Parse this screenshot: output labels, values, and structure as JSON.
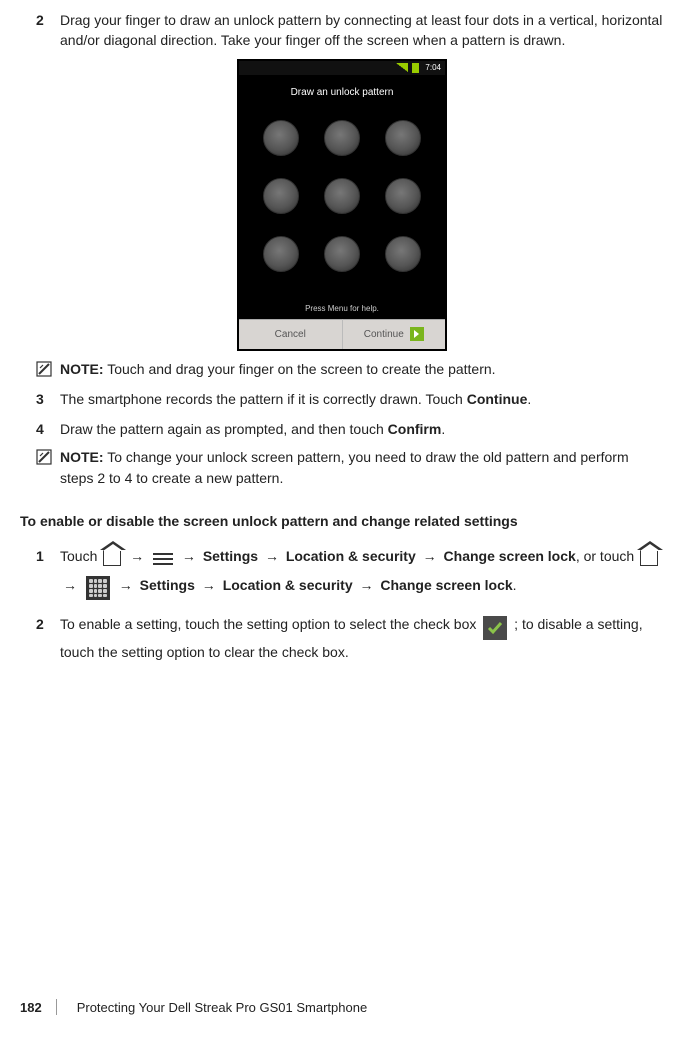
{
  "steps_a": {
    "s2": {
      "num": "2",
      "text_a": "Drag your finger to draw an unlock pattern by connecting at least four dots in a vertical, horizontal and/or diagonal direction. Take your finger off the screen when a pattern is drawn."
    },
    "s3": {
      "num": "3",
      "text_a": "The smartphone records the pattern if it is correctly drawn. Touch ",
      "text_b": "Continue",
      "text_c": "."
    },
    "s4": {
      "num": "4",
      "text_a": "Draw the pattern again as prompted, and then touch ",
      "text_b": "Confirm",
      "text_c": "."
    }
  },
  "phone": {
    "time": "7:04",
    "title": "Draw an unlock pattern",
    "help": "Press Menu for help.",
    "cancel": "Cancel",
    "continue": "Continue"
  },
  "notes": {
    "label": "NOTE:",
    "n1": " Touch and drag your finger on the screen to create the pattern.",
    "n2": " To change your unlock screen pattern, you need to draw the old pattern and perform steps 2 to 4 to create a new pattern."
  },
  "section_heading": "To enable or disable the screen unlock pattern and change related settings",
  "steps_b": {
    "s1": {
      "num": "1",
      "t1": "Touch ",
      "arrow": "→",
      "t2": " Settings ",
      "t3": " Location & security ",
      "t4": " Change screen lock",
      "t5": ", or touch ",
      "t6": " Settings ",
      "t7": " Location & security ",
      "t8": " Change screen lock",
      "t9": "."
    },
    "s2": {
      "num": "2",
      "t1": "To enable a setting, touch the setting option to select the check box ",
      "t2": " ; to disable a setting, touch the setting option to clear the check box."
    }
  },
  "footer": {
    "page": "182",
    "title": "Protecting Your Dell Streak Pro GS01 Smartphone"
  }
}
